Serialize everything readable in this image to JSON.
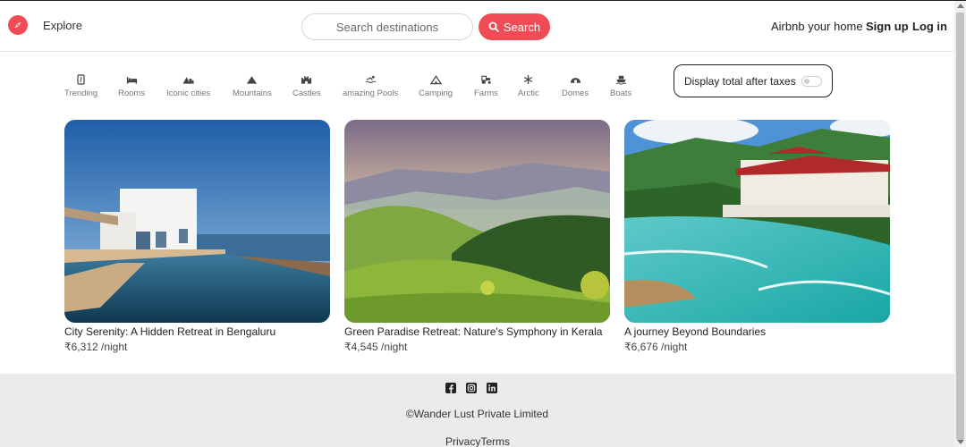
{
  "navbar": {
    "explore_label": "Explore",
    "search_placeholder": "Search destinations",
    "search_button_label": "Search",
    "airbnb_home_label": "Airbnb your home",
    "signup_label": "Sign up",
    "login_label": "Log in",
    "brand_color": "#f14c55"
  },
  "categories": [
    {
      "label": "Trending",
      "icon": "fire-icon"
    },
    {
      "label": "Rooms",
      "icon": "bed-icon"
    },
    {
      "label": "Iconic cities",
      "icon": "mountain-city-icon"
    },
    {
      "label": "Mountains",
      "icon": "mountain-icon"
    },
    {
      "label": "Castles",
      "icon": "castle-icon"
    },
    {
      "label": "amazing Pools",
      "icon": "swimmer-icon"
    },
    {
      "label": "Camping",
      "icon": "campground-icon"
    },
    {
      "label": "Farms",
      "icon": "tractor-icon"
    },
    {
      "label": "Arctic",
      "icon": "snowflake-icon"
    },
    {
      "label": "Domes",
      "icon": "igloo-icon"
    },
    {
      "label": "Boats",
      "icon": "ferry-icon"
    }
  ],
  "tax_toggle": {
    "label": "Display total after taxes",
    "enabled": false
  },
  "listings": [
    {
      "title": "City Serenity: A Hidden Retreat in Bengaluru",
      "price": "₹6,312 /night"
    },
    {
      "title": "Green Paradise Retreat: Nature's Symphony in Kerala",
      "price": "₹4,545 /night"
    },
    {
      "title": "A journey Beyond Boundaries",
      "price": "₹6,676 /night"
    }
  ],
  "footer": {
    "socials": [
      "facebook-icon",
      "instagram-icon",
      "linkedin-icon"
    ],
    "copyright": "©Wander Lust Private Limited",
    "privacy_label": "Privacy",
    "terms_label": "Terms"
  }
}
